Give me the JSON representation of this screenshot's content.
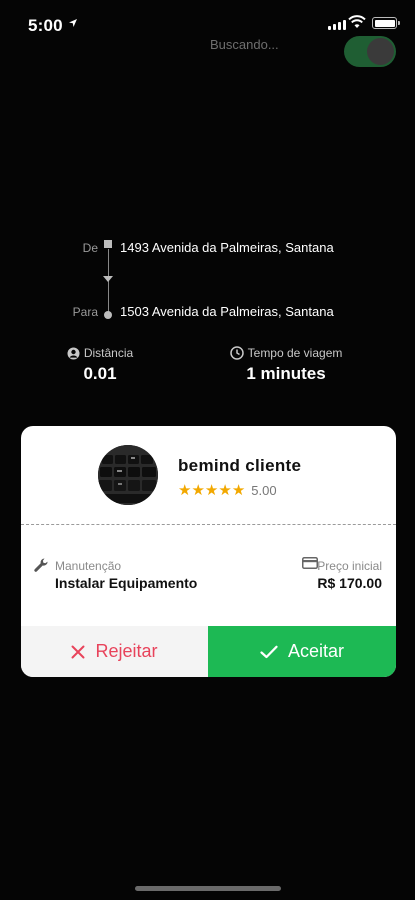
{
  "status_bar": {
    "time": "5:00"
  },
  "search": {
    "label": "Buscando...",
    "toggle_on": true
  },
  "route": {
    "from_label": "De",
    "from_address": "1493 Avenida da Palmeiras, Santana",
    "to_label": "Para",
    "to_address": "1503 Avenida da Palmeiras, Santana"
  },
  "stats": {
    "distance_label": "Distância",
    "distance_value": "0.01",
    "time_label": "Tempo de viagem",
    "time_value": "1 minutes"
  },
  "card": {
    "client_name": "bemind cliente",
    "rating_value": "5.00",
    "stars": 5,
    "service_label": "Manutenção",
    "service_value": "Instalar Equipamento",
    "price_label": "Preço inicial",
    "price_value": "R$ 170.00",
    "reject_label": "Rejeitar",
    "accept_label": "Aceitar"
  },
  "colors": {
    "accept": "#1db954",
    "reject_text": "#e8435b",
    "star": "#f2a800",
    "toggle": "#1f5e33"
  }
}
